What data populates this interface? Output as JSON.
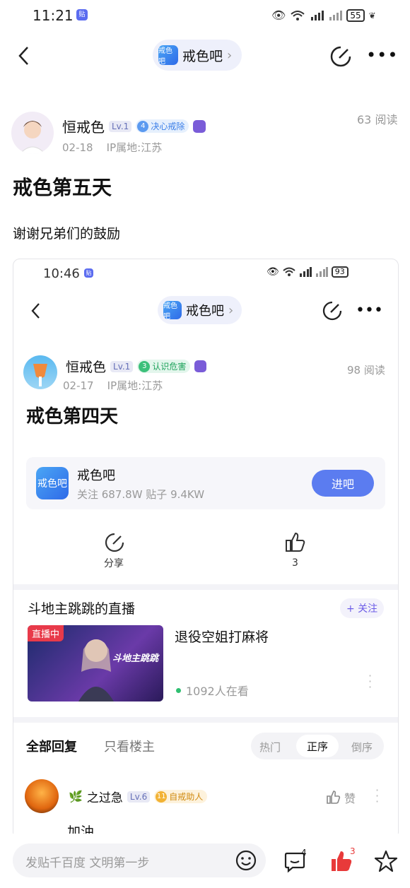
{
  "status_bar": {
    "time": "11:21",
    "battery": "55"
  },
  "nav": {
    "forum_name": "戒色吧",
    "logo_text": "戒色吧"
  },
  "post": {
    "author": "恒戒色",
    "level": "Lv.1",
    "badge_num": "4",
    "badge_text": "决心戒除",
    "date": "02-18",
    "ip": "IP属地:江苏",
    "views": "63 阅读",
    "title": "戒色第五天",
    "body": "谢谢兄弟们的鼓励"
  },
  "screenshot": {
    "status_time": "10:46",
    "battery": "93",
    "forum_name": "戒色吧",
    "author": "恒戒色",
    "level": "Lv.1",
    "badge_num": "3",
    "badge_text": "认识危害",
    "date": "02-17",
    "ip": "IP属地:江苏",
    "views": "98 阅读",
    "title": "戒色第四天",
    "forum_card": {
      "name": "戒色吧",
      "stats": "关注 687.8W  贴子 9.4KW",
      "join_label": "进吧"
    },
    "share_label": "分享",
    "like_count": "3",
    "live": {
      "channel": "斗地主跳跳的直播",
      "follow_label": "+ 关注",
      "badge": "直播中",
      "thumb_text": "斗地主跳跳",
      "title": "退役空姐打麻将",
      "viewers": "1092人在看"
    },
    "tabs": {
      "all": "全部回复",
      "op_only": "只看楼主",
      "sort_hot": "热门",
      "sort_asc": "正序",
      "sort_desc": "倒序"
    },
    "reply": {
      "user": "之过急",
      "level": "Lv.6",
      "badge_num": "11",
      "badge_text": "自戒助人",
      "like_label": "赞",
      "text": "加油"
    }
  },
  "bottom_bar": {
    "placeholder": "发贴千百度 文明第一步",
    "comment_count": "4",
    "like_count": "3"
  }
}
